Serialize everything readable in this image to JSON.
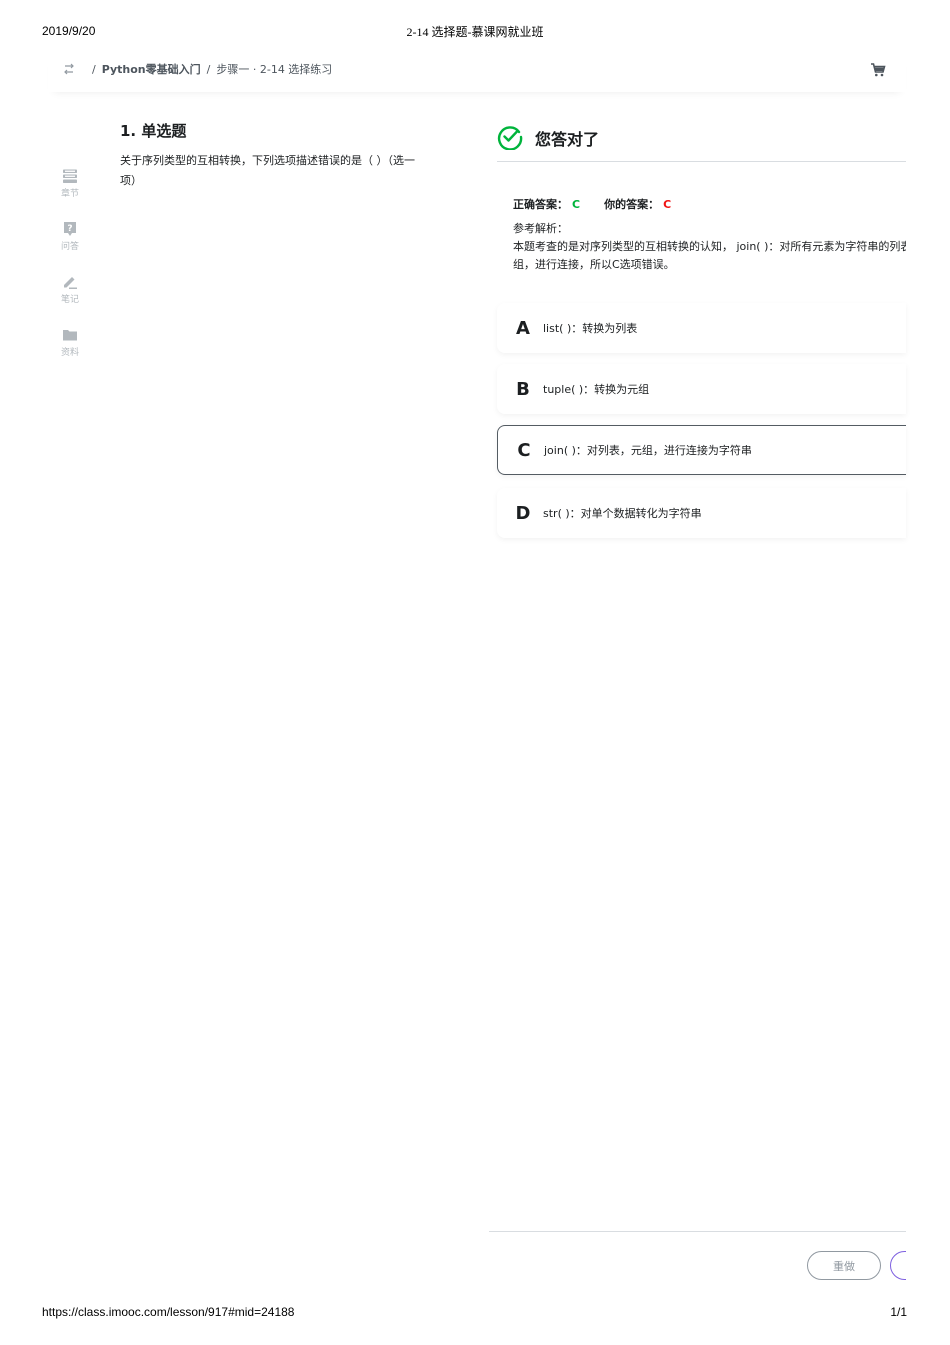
{
  "print": {
    "date": "2019/9/20",
    "title": "2-14 选择题-慕课网就业班",
    "url": "https://class.imooc.com/lesson/917#mid=24188",
    "page": "1/1"
  },
  "breadcrumb": {
    "course": "Python零基础入门",
    "separator": "/",
    "step": "步骤一 · 2-14 选择练习"
  },
  "sidebar": {
    "items": [
      {
        "label": "章节",
        "icon": "chapter-icon"
      },
      {
        "label": "问答",
        "icon": "question-icon"
      },
      {
        "label": "笔记",
        "icon": "note-icon"
      },
      {
        "label": "资料",
        "icon": "folder-icon"
      }
    ]
  },
  "question": {
    "title": "1. 单选题",
    "text": "关于序列类型的互相转换，下列选项描述错误的是（ ）（选一项）"
  },
  "result": {
    "message": "您答对了",
    "correct_label": "正确答案：",
    "correct_value": "C",
    "yours_label": "你的答案：",
    "yours_value": "C",
    "analysis_label": "参考解析：",
    "analysis_line1": "本题考查的是对序列类型的互相转换的认知， join( )：对所有元素为字符串的列表",
    "analysis_line2": "组，进行连接，所以C选项错误。"
  },
  "options": [
    {
      "letter": "A",
      "text": "list( )：转换为列表",
      "selected": false
    },
    {
      "letter": "B",
      "text": "tuple( )：转换为元组",
      "selected": false
    },
    {
      "letter": "C",
      "text": "join( )：对列表，元组，进行连接为字符串",
      "selected": true
    },
    {
      "letter": "D",
      "text": "str( )：对单个数据转化为字符串",
      "selected": false
    }
  ],
  "footer": {
    "redo_label": "重做"
  },
  "colors": {
    "correct_green": "#00b43c",
    "answer_red": "#f01414",
    "next_purple": "#7e60e0"
  }
}
